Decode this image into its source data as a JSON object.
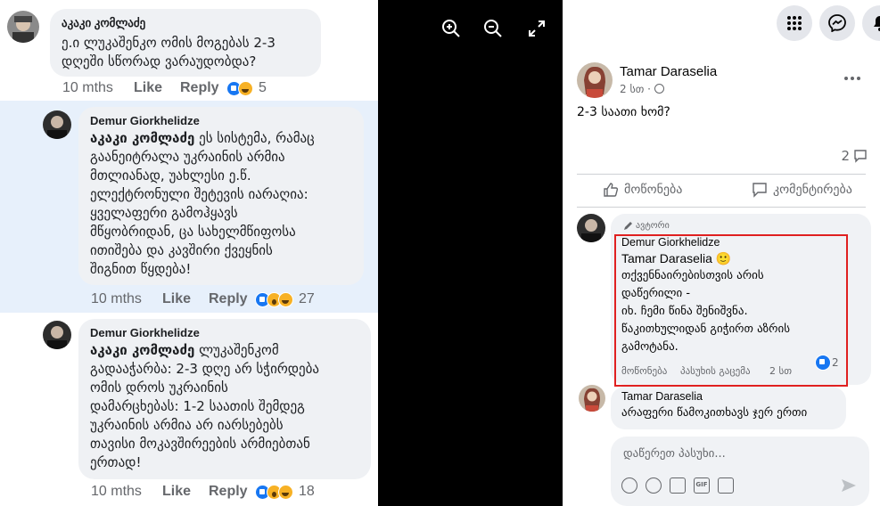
{
  "left_comments": [
    {
      "author": "აკაკი კომლაძე",
      "text": "ე.ი ლუკაშენკო ომის მოგებას 2-3\nდღეში სწორად ვარაუდობდა?",
      "time": "10 mths",
      "like": "Like",
      "reply": "Reply",
      "reaction_count": "5"
    },
    {
      "author": "Demur Giorkhelidze",
      "mention": "აკაკი კომლაძე",
      "text": " ეს სისტემა, რამაც\nგაანეიტრალა უკრაინის არმია\nმთლიანად, უახლესი ე.წ.\nელექტრონული შეტევის იარაღია:\nყველაფერი გამოჰყავს\nმწყობრიდან, ცა სახელმწიფოსა\nითიშება და კავშირი ქვეყნის\nშიგნით წყდება!",
      "time": "10 mths",
      "like": "Like",
      "reply": "Reply",
      "reaction_count": "27"
    },
    {
      "author": "Demur Giorkhelidze",
      "mention": "აკაკი კომლაძე",
      "text": " ლუკაშენკომ\nგადააჭარბა: 2-3 დღე არ სჭირდება\nომის დროს უკრაინის\nდამარცხებას: 1-2 საათის შემდეგ\nუკრაინის არმია არ იარსებებს\nთავისი მოკავშირეების არმიებთან\nერთად!",
      "time": "10 mths",
      "like": "Like",
      "reply": "Reply",
      "reaction_count": "18"
    }
  ],
  "viewer": {
    "zoom_in": "zoom-in-icon",
    "zoom_out": "zoom-out-icon",
    "fullscreen": "fullscreen-icon"
  },
  "post": {
    "author": "Tamar Daraselia",
    "time": "2 სთ · ",
    "text": "2-3 საათი ხომ?",
    "comment_count": "2",
    "like_label": "მოწონება",
    "comment_label": "კომენტირება"
  },
  "highlighted_comment": {
    "badge": "ავტორი",
    "author": "Demur Giorkhelidze",
    "addressee": "Tamar Daraselia",
    "emoji": "🙂",
    "lines": [
      "თქვენნაირებისთვის არის",
      "დაწერილი -",
      "იხ. ჩემი წინა შენიშვნა.",
      "წაკითხულიდან გიჭირთ აზრის",
      "გამოტანა."
    ],
    "like": "მოწონება",
    "reply": "პასუხის გაცემა",
    "time": "2 სთ",
    "reaction_count": "2"
  },
  "next_comment": {
    "author": "Tamar Daraselia",
    "text_line1": "არაფერი წამოკითხავს ჯერ ერთი"
  },
  "reply_box": {
    "placeholder": "დაწერეთ პასუხი..."
  },
  "colors": {
    "accent": "#1877f2",
    "highlight_bg": "#e7f0fb",
    "red_box": "#e02020"
  }
}
